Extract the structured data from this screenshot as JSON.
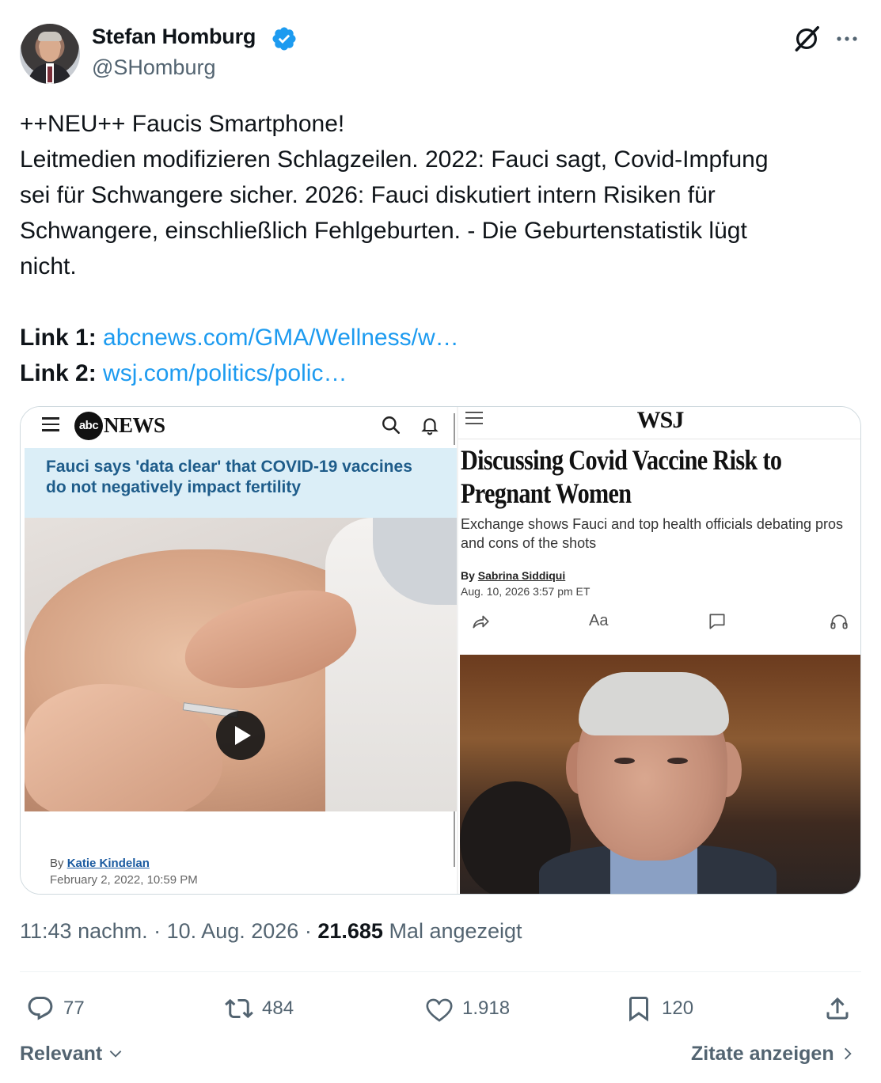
{
  "author": {
    "name": "Stefan Homburg",
    "handle": "@SHomburg"
  },
  "tweet": {
    "lines": [
      "++NEU++ Faucis Smartphone!",
      "Leitmedien modifizieren Schlagzeilen. 2022: Fauci sagt, Covid-Impfung",
      "sei für Schwangere sicher. 2026: Fauci diskutiert intern Risiken für",
      "Schwangere, einschließlich Fehlgeburten. - Die Geburtenstatistik lügt",
      "nicht."
    ],
    "links": [
      {
        "label": "Link 1:",
        "url": "abcnews.com/GMA/Wellness/w…"
      },
      {
        "label": "Link 2:",
        "url": "wsj.com/politics/polic…"
      }
    ]
  },
  "media": {
    "abc": {
      "logo_badge": "abc",
      "logo_text": "NEWS",
      "headline": "Fauci says 'data clear' that COVID-19 vaccines do not negatively impact fertility",
      "byline_prefix": "By",
      "author": "Katie Kindelan",
      "date": "February 2, 2022, 10:59 PM"
    },
    "wsj": {
      "logo": "WSJ",
      "headline": "Discussing Covid Vaccine Risk to Pregnant Women",
      "subhead": "Exchange shows Fauci and top health officials debating pros and cons of the shots",
      "byline_prefix": "By",
      "author": "Sabrina Siddiqui",
      "date": "Aug. 10, 2026 3:57 pm ET",
      "text_size_icon_label": "Aa"
    }
  },
  "meta": {
    "time": "11:43 nachm.",
    "sep": "·",
    "date": "10. Aug. 2026",
    "views_count": "21.685",
    "views_label": "Mal angezeigt"
  },
  "actions": {
    "replies": "77",
    "reposts": "484",
    "likes": "1.918",
    "bookmarks": "120"
  },
  "footer": {
    "relevant": "Relevant",
    "quotes": "Zitate anzeigen"
  },
  "colors": {
    "accent": "#1d9bf0",
    "secondary_text": "#536471",
    "abc_headline": "#1e5c8a",
    "abc_band": "#dbeef7"
  }
}
